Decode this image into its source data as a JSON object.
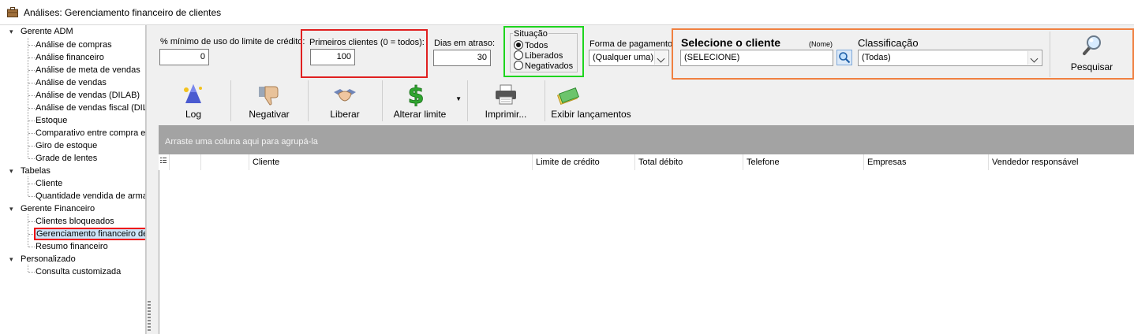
{
  "window": {
    "title": "Análises: Gerenciamento financeiro de clientes",
    "icon": "briefcase-icon"
  },
  "tree": {
    "groups": [
      {
        "label": "Gerente ADM",
        "items": [
          "Análise de compras",
          "Análise financeiro",
          "Análise de meta de vendas",
          "Análise de vendas",
          "Análise de vendas (DILAB)",
          "Análise de vendas fiscal (DILA",
          "Estoque",
          "Comparativo entre compra e",
          "Giro de estoque",
          "Grade de lentes"
        ]
      },
      {
        "label": "Tabelas",
        "items": [
          "Cliente",
          "Quantidade vendida de arma"
        ]
      },
      {
        "label": "Gerente Financeiro",
        "items": [
          "Clientes bloqueados",
          "Gerenciamento financeiro de",
          "Resumo financeiro"
        ]
      },
      {
        "label": "Personalizado",
        "items": [
          "Consulta customizada"
        ]
      }
    ],
    "selected": "Gerenciamento financeiro de"
  },
  "filters": {
    "min_usage": {
      "label": "% mínimo de uso do limite de crédito:",
      "value": "0"
    },
    "first_clients": {
      "label": "Primeiros clientes (0 = todos):",
      "value": "100"
    },
    "days_late": {
      "label": "Dias em atraso:",
      "value": "30"
    },
    "situation": {
      "label": "Situação",
      "options": [
        "Todos",
        "Liberados",
        "Negativados"
      ],
      "selected": "Todos"
    },
    "payment": {
      "label": "Forma de pagamento",
      "value": "(Qualquer uma)"
    },
    "client": {
      "label": "Selecione o cliente",
      "hint": "(Nome)",
      "value": "(SELECIONE)"
    },
    "classification": {
      "label": "Classificação",
      "value": "(Todas)"
    },
    "search_button": "Pesquisar"
  },
  "toolbar": {
    "log": "Log",
    "negativar": "Negativar",
    "liberar": "Liberar",
    "alterar_limite": "Alterar limite",
    "imprimir": "Imprimir...",
    "exibir": "Exibir lançamentos"
  },
  "grid": {
    "group_hint": "Arraste uma coluna aqui para agrupá-la",
    "columns": [
      "Cliente",
      "Limite de crédito",
      "Total débito",
      "Telefone",
      "Empresas",
      "Vendedor responsável"
    ]
  },
  "colors": {
    "highlight_red": "#e02020",
    "highlight_green": "#1ed51e",
    "highlight_orange": "#f08040",
    "group_panel": "#a3a3a3"
  }
}
